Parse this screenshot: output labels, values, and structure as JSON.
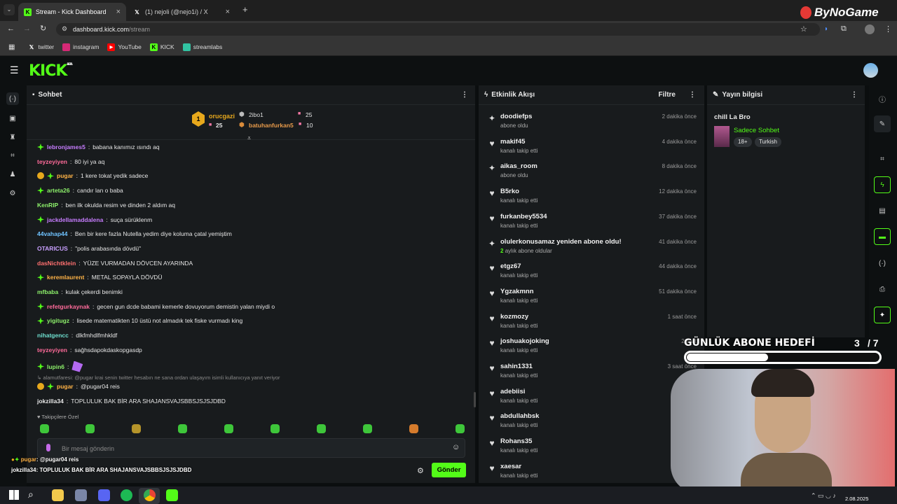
{
  "browser": {
    "tabs": [
      {
        "label": "Stream - Kick Dashboard",
        "active": true
      },
      {
        "label": "(1) nejoli (@nejo1i) / X",
        "active": false
      }
    ],
    "url_host": "dashboard.kick.com",
    "url_path": "/stream",
    "bookmarks": [
      "twitter",
      "instagram",
      "YouTube",
      "KICK",
      "streamlabs"
    ]
  },
  "watermark": "ByNoGame",
  "kick": {
    "logo": "KICK",
    "beta": "BETA"
  },
  "chat": {
    "title": "Sohbet",
    "leaderboard": [
      {
        "rank": "1",
        "name": "orucgazi",
        "count": "25"
      },
      {
        "name": "2ibo1",
        "count": "25"
      },
      {
        "name": "batuhanfurkan5",
        "count": "10"
      }
    ],
    "messages": [
      {
        "user": "lebronjames5",
        "text": "babana kanımız ısındı aq",
        "color": "#c77dff"
      },
      {
        "user": "teyzeyiyen",
        "text": "80 iyi ya aq",
        "color": "#ff6b9a"
      },
      {
        "user": "pugar",
        "text": "1 kere tokat yedik sadece",
        "color": "#ffb347"
      },
      {
        "user": "arteta26",
        "text": "candır lan o baba",
        "color": "#8df06b"
      },
      {
        "user": "KenRIP",
        "text": "ben ilk okulda resim ve dinden 2 aldım aq",
        "color": "#8df06b"
      },
      {
        "user": "jackdellamaddalena",
        "text": "suça sürüklenm",
        "color": "#c77dff"
      },
      {
        "user": "44vahap44",
        "text": "Ben bir kere fazla Nutella yedim diye koluma çatal yemiştim",
        "color": "#6fc3ff"
      },
      {
        "user": "OTARICUS",
        "text": "\"polis arabasında dövdü\"",
        "color": "#c9a0ff"
      },
      {
        "user": "dasNichtklein",
        "text": "YÜZE VURMADAN DÖVCEN AYARINDA",
        "color": "#ff7070"
      },
      {
        "user": "keremlaurent",
        "text": "METAL SOPAYLA DÖVDÜ",
        "color": "#ffb347"
      },
      {
        "user": "mfbaba",
        "text": "kulak çekerdi benimki",
        "color": "#8df06b"
      },
      {
        "user": "refetgurkaynak",
        "text": "gecen gun dcde babami kemerle dovuyorum demistin yalan miydi o",
        "color": "#ff6b9a"
      },
      {
        "user": "yigitugz",
        "text": "lisede matematikten 10 üstü not almadık tek fiske vurmadı king",
        "color": "#8df06b"
      },
      {
        "user": "nihatgencc",
        "text": "dlkfmhdlfmhkldf",
        "color": "#6fe0d0"
      },
      {
        "user": "teyzeyiyen",
        "text": "sağhsdapokdaskopgasdp",
        "color": "#ff6b9a"
      },
      {
        "user": "lupin6",
        "text": "",
        "color": "#8df06b"
      }
    ],
    "reply_hint": "alamutfaresi: @pugar krai senin twitter hesabın ne sana ordan ulaşayım isimli kullanıcıya yanıt veriyor",
    "reply_user": "pugar",
    "reply_text": "@pugar04 reis",
    "last_user": "jokzilla34",
    "last_text": "TOPLULUK BAK BİR ARA SHAJANSVAJSBBSJSJSJDBD",
    "followers_only": "Takipçilere Özel",
    "input_placeholder": "Bir mesaj gönderin",
    "send_label": "Gönder"
  },
  "overlay": {
    "line1_user": "pugar",
    "line1_text": ": @pugar04 reis",
    "line2_user": "jokzilla34",
    "line2_text": ": TOPLULUK BAK BİR ARA SHAJANSVAJSBBSJSJSJDBD"
  },
  "activity": {
    "title": "Etkinlik Akışı",
    "filter_label": "Filtre",
    "events": [
      {
        "icon": "sparkle-icon",
        "name": "doodiefps",
        "sub": "abone oldu",
        "time": "2 dakika önce"
      },
      {
        "icon": "heart-icon",
        "name": "makif45",
        "sub": "kanalı takip etti",
        "time": "4 dakika önce"
      },
      {
        "icon": "sparkle-icon",
        "name": "aikas_room",
        "sub": "abone oldu",
        "time": "8 dakika önce"
      },
      {
        "icon": "heart-icon",
        "name": "B5rko",
        "sub": "kanalı takip etti",
        "time": "12 dakika önce"
      },
      {
        "icon": "heart-icon",
        "name": "furkanbey5534",
        "sub": "kanalı takip etti",
        "time": "37 dakika önce"
      },
      {
        "icon": "sparkle-icon",
        "name": "olulerkonusamaz yeniden abone oldu!",
        "sub_strong": "2",
        "sub": "aylık abone oldular",
        "time": "41 dakika önce"
      },
      {
        "icon": "heart-icon",
        "name": "etgz67",
        "sub": "kanalı takip etti",
        "time": "44 dakika önce"
      },
      {
        "icon": "heart-icon",
        "name": "Ygzakmnn",
        "sub": "kanalı takip etti",
        "time": "51 dakika önce"
      },
      {
        "icon": "heart-icon",
        "name": "kozmozy",
        "sub": "kanalı takip etti",
        "time": "1 saat önce"
      },
      {
        "icon": "heart-icon",
        "name": "joshuakojoking",
        "sub": "kanalı takip etti",
        "time": "2 saat"
      },
      {
        "icon": "heart-icon",
        "name": "sahin1331",
        "sub": "kanalı takip etti",
        "time": "3 saat önce"
      },
      {
        "icon": "heart-icon",
        "name": "adebiisi",
        "sub": "kanalı takip etti",
        "time": "4"
      },
      {
        "icon": "heart-icon",
        "name": "abdullahbsk",
        "sub": "kanalı takip etti",
        "time": "8"
      },
      {
        "icon": "heart-icon",
        "name": "Rohans35",
        "sub": "kanalı takip etti",
        "time": "8"
      },
      {
        "icon": "heart-icon",
        "name": "xaesar",
        "sub": "kanalı takip etti",
        "time": "11"
      }
    ]
  },
  "stream_info": {
    "title": "Yayın bilgisi",
    "stream_title": "chill La Bro",
    "category": "Sadece Sohbet",
    "tags": [
      "18+",
      "Turkish"
    ]
  },
  "sub_goal": {
    "label": "GÜNLÜK ABONE HEDEFİ",
    "current": "3",
    "target": "/ 7",
    "progress": 0.43
  },
  "taskbar": {
    "date": "2.08.2025"
  },
  "colors": {
    "kick_green": "#53fc18",
    "panel": "#181b1d"
  }
}
